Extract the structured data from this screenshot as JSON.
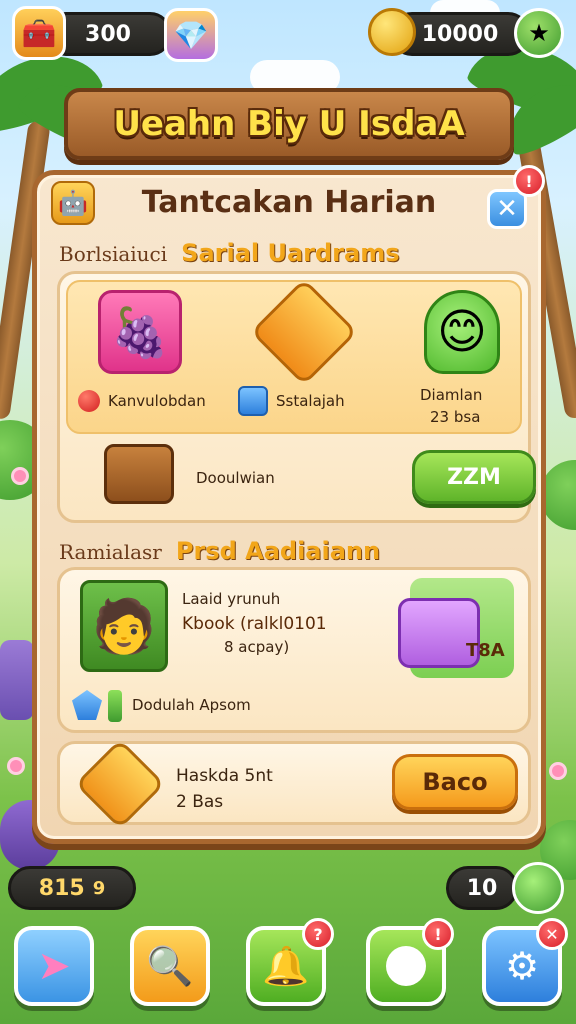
{
  "hud": {
    "left_counter": "300",
    "right_counter": "10000"
  },
  "banner": {
    "title": "Ueahn Biy U IsdaA"
  },
  "panel": {
    "title": "Tantcakan Harian",
    "close_symbol": "✕",
    "alert_symbol": "!"
  },
  "daily": {
    "sub": "Borlsiaiuci",
    "main": "Sarial Uardrams",
    "rewards": [
      {
        "icon": "fruit-basket-icon",
        "label": "Kanvulobdan"
      },
      {
        "icon": "golden-box-icon",
        "label": "Sstalajah"
      },
      {
        "icon": "green-slime-icon",
        "label": "Diamlan",
        "sub": "23 bsa"
      }
    ],
    "chest_label": "Dooulwian",
    "claim_button": "ZZM"
  },
  "partner": {
    "sub": "Ramialasr",
    "main": "Prsd Aadiaiann",
    "lines": [
      "Laaid yrunuh",
      "Kbook (ralkl0101",
      "8 acpay)"
    ],
    "gem_label": "Dodulah Apsom",
    "reward_badge": "T8A",
    "task_title": "Haskda 5nt",
    "task_sub": "2 Bas",
    "go_button": "Baco"
  },
  "bottom": {
    "left_value": "815",
    "left_badge": "9",
    "right_value": "10"
  },
  "nav": [
    {
      "icon": "arrow-icon",
      "color": "#5ab4f0"
    },
    {
      "icon": "magnifier-icon",
      "color": "#f7b02a"
    },
    {
      "icon": "bell-icon",
      "color": "#66c23a",
      "badge": "?"
    },
    {
      "icon": "egg-icon",
      "color": "#66c23a",
      "badge": "!"
    },
    {
      "icon": "gear-icon",
      "color": "#3a8fe0",
      "badge": "✕"
    }
  ]
}
